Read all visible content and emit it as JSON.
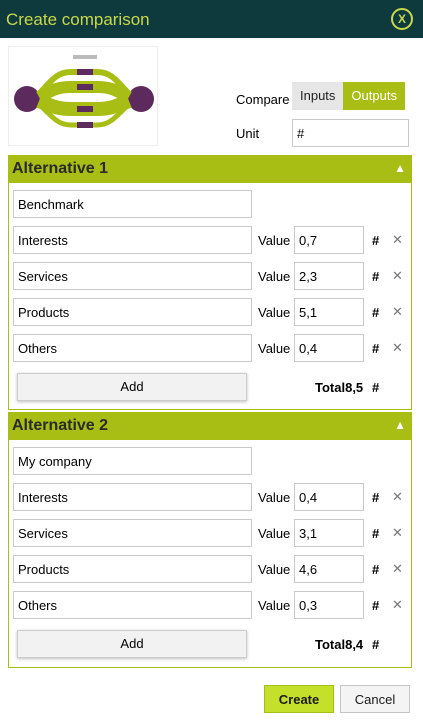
{
  "dialog": {
    "title": "Create comparison",
    "close_label": "X"
  },
  "header": {
    "compare_label": "Compare",
    "toggle": {
      "inputs": "Inputs",
      "outputs": "Outputs",
      "selected": "Outputs"
    },
    "unit_label": "Unit",
    "unit_value": "#"
  },
  "alternatives": [
    {
      "title": "Alternative 1",
      "name": "Benchmark",
      "rows": [
        {
          "name": "Interests",
          "value_label": "Value",
          "value": "0,7",
          "unit": "#"
        },
        {
          "name": "Services",
          "value_label": "Value",
          "value": "2,3",
          "unit": "#"
        },
        {
          "name": "Products",
          "value_label": "Value",
          "value": "5,1",
          "unit": "#"
        },
        {
          "name": "Others",
          "value_label": "Value",
          "value": "0,4",
          "unit": "#"
        }
      ],
      "add_label": "Add",
      "total_label": "Total",
      "total_value": "8,5",
      "total_unit": "#"
    },
    {
      "title": "Alternative 2",
      "name": "My company",
      "rows": [
        {
          "name": "Interests",
          "value_label": "Value",
          "value": "0,4",
          "unit": "#"
        },
        {
          "name": "Services",
          "value_label": "Value",
          "value": "3,1",
          "unit": "#"
        },
        {
          "name": "Products",
          "value_label": "Value",
          "value": "4,6",
          "unit": "#"
        },
        {
          "name": "Others",
          "value_label": "Value",
          "value": "0,3",
          "unit": "#"
        }
      ],
      "add_label": "Add",
      "total_label": "Total",
      "total_value": "8,4",
      "total_unit": "#"
    }
  ],
  "footer": {
    "create_label": "Create",
    "cancel_label": "Cancel"
  },
  "colors": {
    "titlebar": "#0f3a3d",
    "accent": "#a9be14",
    "title_text": "#c8d84a",
    "create_button": "#c4e02a"
  },
  "icons": {
    "close": "close-icon",
    "collapse": "chevron-up-icon",
    "delete": "delete-icon"
  }
}
